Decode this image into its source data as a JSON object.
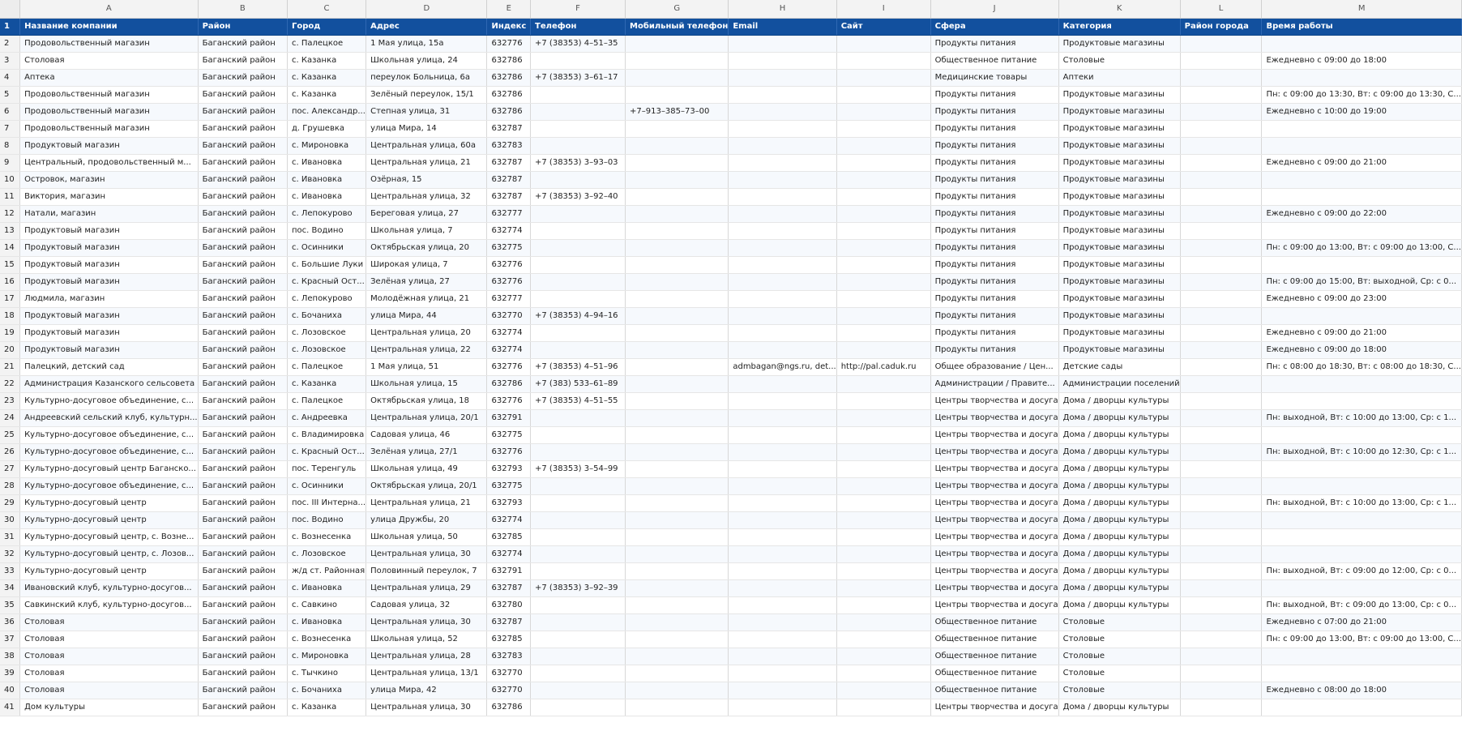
{
  "columns": [
    "A",
    "B",
    "C",
    "D",
    "E",
    "F",
    "G",
    "H",
    "I",
    "J",
    "K",
    "L",
    "M"
  ],
  "headers": [
    "Название компании",
    "Район",
    "Город",
    "Адрес",
    "Индекс",
    "Телефон",
    "Мобильный телефон",
    "Email",
    "Сайт",
    "Сфера",
    "Категория",
    "Район города",
    "Время работы"
  ],
  "rows": [
    {
      "n": "2",
      "cells": [
        "Продовольственный магазин",
        "Баганский район",
        "с. Палецкое",
        "1 Мая улица, 15а",
        "632776",
        "+7 (38353) 4–51–35",
        "",
        "",
        "",
        "Продукты питания",
        "Продуктовые магазины",
        "",
        ""
      ]
    },
    {
      "n": "3",
      "cells": [
        "Столовая",
        "Баганский район",
        "с. Казанка",
        "Школьная улица, 24",
        "632786",
        "",
        "",
        "",
        "",
        "Общественное питание",
        "Столовые",
        "",
        "Ежедневно с 09:00 до 18:00"
      ]
    },
    {
      "n": "4",
      "cells": [
        "Аптека",
        "Баганский район",
        "с. Казанка",
        "переулок Больница, 6а",
        "632786",
        "+7 (38353) 3–61–17",
        "",
        "",
        "",
        "Медицинские товары",
        "Аптеки",
        "",
        ""
      ]
    },
    {
      "n": "5",
      "cells": [
        "Продовольственный магазин",
        "Баганский район",
        "с. Казанка",
        "Зелёный переулок, 15/1",
        "632786",
        "",
        "",
        "",
        "",
        "Продукты питания",
        "Продуктовые магазины",
        "",
        "Пн: с 09:00 до 13:30, Вт: с 09:00 до 13:30, С..."
      ]
    },
    {
      "n": "6",
      "cells": [
        "Продовольственный магазин",
        "Баганский район",
        "пос. Александр...",
        "Степная улица, 31",
        "632786",
        "",
        "+7–913–385–73–00",
        "",
        "",
        "Продукты питания",
        "Продуктовые магазины",
        "",
        "Ежедневно с 10:00 до 19:00"
      ]
    },
    {
      "n": "7",
      "cells": [
        "Продовольственный магазин",
        "Баганский район",
        "д. Грушевка",
        "улица Мира, 14",
        "632787",
        "",
        "",
        "",
        "",
        "Продукты питания",
        "Продуктовые магазины",
        "",
        ""
      ]
    },
    {
      "n": "8",
      "cells": [
        "Продуктовый магазин",
        "Баганский район",
        "с. Мироновка",
        "Центральная улица, 60а",
        "632783",
        "",
        "",
        "",
        "",
        "Продукты питания",
        "Продуктовые магазины",
        "",
        ""
      ]
    },
    {
      "n": "9",
      "cells": [
        "Центральный, продовольственный м...",
        "Баганский район",
        "с. Ивановка",
        "Центральная улица, 21",
        "632787",
        "+7 (38353) 3–93–03",
        "",
        "",
        "",
        "Продукты питания",
        "Продуктовые магазины",
        "",
        "Ежедневно с 09:00 до 21:00"
      ]
    },
    {
      "n": "10",
      "cells": [
        "Островок, магазин",
        "Баганский район",
        "с. Ивановка",
        "Озёрная, 15",
        "632787",
        "",
        "",
        "",
        "",
        "Продукты питания",
        "Продуктовые магазины",
        "",
        ""
      ]
    },
    {
      "n": "11",
      "cells": [
        "Виктория, магазин",
        "Баганский район",
        "с. Ивановка",
        "Центральная улица, 32",
        "632787",
        "+7 (38353) 3–92–40",
        "",
        "",
        "",
        "Продукты питания",
        "Продуктовые магазины",
        "",
        ""
      ]
    },
    {
      "n": "12",
      "cells": [
        "Натали, магазин",
        "Баганский район",
        "с. Лепокурово",
        "Береговая улица, 27",
        "632777",
        "",
        "",
        "",
        "",
        "Продукты питания",
        "Продуктовые магазины",
        "",
        "Ежедневно с 09:00 до 22:00"
      ]
    },
    {
      "n": "13",
      "cells": [
        "Продуктовый магазин",
        "Баганский район",
        "пос. Водино",
        "Школьная улица, 7",
        "632774",
        "",
        "",
        "",
        "",
        "Продукты питания",
        "Продуктовые магазины",
        "",
        ""
      ]
    },
    {
      "n": "14",
      "cells": [
        "Продуктовый магазин",
        "Баганский район",
        "с. Осинники",
        "Октябрьская улица, 20",
        "632775",
        "",
        "",
        "",
        "",
        "Продукты питания",
        "Продуктовые магазины",
        "",
        "Пн: с 09:00 до 13:00, Вт: с 09:00 до 13:00, С..."
      ]
    },
    {
      "n": "15",
      "cells": [
        "Продуктовый магазин",
        "Баганский район",
        "с. Большие Луки",
        "Широкая улица, 7",
        "632776",
        "",
        "",
        "",
        "",
        "Продукты питания",
        "Продуктовые магазины",
        "",
        ""
      ]
    },
    {
      "n": "16",
      "cells": [
        "Продуктовый магазин",
        "Баганский район",
        "с. Красный Ост...",
        "Зелёная улица, 27",
        "632776",
        "",
        "",
        "",
        "",
        "Продукты питания",
        "Продуктовые магазины",
        "",
        "Пн: с 09:00 до 15:00, Вт: выходной, Ср: с 0..."
      ]
    },
    {
      "n": "17",
      "cells": [
        "Людмила, магазин",
        "Баганский район",
        "с. Лепокурово",
        "Молодёжная улица, 21",
        "632777",
        "",
        "",
        "",
        "",
        "Продукты питания",
        "Продуктовые магазины",
        "",
        "Ежедневно с 09:00 до 23:00"
      ]
    },
    {
      "n": "18",
      "cells": [
        "Продуктовый магазин",
        "Баганский район",
        "с. Бочаниха",
        "улица Мира, 44",
        "632770",
        "+7 (38353) 4–94–16",
        "",
        "",
        "",
        "Продукты питания",
        "Продуктовые магазины",
        "",
        ""
      ]
    },
    {
      "n": "19",
      "cells": [
        "Продуктовый магазин",
        "Баганский район",
        "с. Лозовское",
        "Центральная улица, 20",
        "632774",
        "",
        "",
        "",
        "",
        "Продукты питания",
        "Продуктовые магазины",
        "",
        "Ежедневно с 09:00 до 21:00"
      ]
    },
    {
      "n": "20",
      "cells": [
        "Продуктовый магазин",
        "Баганский район",
        "с. Лозовское",
        "Центральная улица, 22",
        "632774",
        "",
        "",
        "",
        "",
        "Продукты питания",
        "Продуктовые магазины",
        "",
        "Ежедневно с 09:00 до 18:00"
      ]
    },
    {
      "n": "21",
      "cells": [
        "Палецкий, детский сад",
        "Баганский район",
        "с. Палецкое",
        "1 Мая улица, 51",
        "632776",
        "+7 (38353) 4–51–96",
        "",
        "admbagan@ngs.ru, det...",
        "http://pal.caduk.ru",
        "Общее образование / Цен...",
        "Детские сады",
        "",
        "Пн: с 08:00 до 18:30, Вт: с 08:00 до 18:30, С..."
      ]
    },
    {
      "n": "22",
      "cells": [
        "Администрация Казанского сельсовета",
        "Баганский район",
        "с. Казанка",
        "Школьная улица, 15",
        "632786",
        "+7 (383) 533–61–89",
        "",
        "",
        "",
        "Администрации / Правите...",
        "Администрации поселений",
        "",
        ""
      ]
    },
    {
      "n": "23",
      "cells": [
        "Культурно-досуговое объединение, с...",
        "Баганский район",
        "с. Палецкое",
        "Октябрьская улица, 18",
        "632776",
        "+7 (38353) 4–51–55",
        "",
        "",
        "",
        "Центры творчества и досуга",
        "Дома / дворцы культуры",
        "",
        ""
      ]
    },
    {
      "n": "24",
      "cells": [
        "Андреевский сельский клуб, культурн...",
        "Баганский район",
        "с. Андреевка",
        "Центральная улица, 20/1",
        "632791",
        "",
        "",
        "",
        "",
        "Центры творчества и досуга",
        "Дома / дворцы культуры",
        "",
        "Пн: выходной, Вт: с 10:00 до 13:00, Ср: с 1..."
      ]
    },
    {
      "n": "25",
      "cells": [
        "Культурно-досуговое объединение, с...",
        "Баганский район",
        "с. Владимировка",
        "Садовая улица, 46",
        "632775",
        "",
        "",
        "",
        "",
        "Центры творчества и досуга",
        "Дома / дворцы культуры",
        "",
        ""
      ]
    },
    {
      "n": "26",
      "cells": [
        "Культурно-досуговое объединение, с...",
        "Баганский район",
        "с. Красный Ост...",
        "Зелёная улица, 27/1",
        "632776",
        "",
        "",
        "",
        "",
        "Центры творчества и досуга",
        "Дома / дворцы культуры",
        "",
        "Пн: выходной, Вт: с 10:00 до 12:30, Ср: с 1..."
      ]
    },
    {
      "n": "27",
      "cells": [
        "Культурно-досуговый центр Баганско...",
        "Баганский район",
        "пос. Теренгуль",
        "Школьная улица, 49",
        "632793",
        "+7 (38353) 3–54–99",
        "",
        "",
        "",
        "Центры творчества и досуга",
        "Дома / дворцы культуры",
        "",
        ""
      ]
    },
    {
      "n": "28",
      "cells": [
        "Культурно-досуговое объединение, с...",
        "Баганский район",
        "с. Осинники",
        "Октябрьская улица, 20/1",
        "632775",
        "",
        "",
        "",
        "",
        "Центры творчества и досуга",
        "Дома / дворцы культуры",
        "",
        ""
      ]
    },
    {
      "n": "29",
      "cells": [
        "Культурно-досуговый центр",
        "Баганский район",
        "пос. III Интерна...",
        "Центральная улица, 21",
        "632793",
        "",
        "",
        "",
        "",
        "Центры творчества и досуга",
        "Дома / дворцы культуры",
        "",
        "Пн: выходной, Вт: с 10:00 до 13:00, Ср: с 1..."
      ]
    },
    {
      "n": "30",
      "cells": [
        "Культурно-досуговый центр",
        "Баганский район",
        "пос. Водино",
        "улица Дружбы, 20",
        "632774",
        "",
        "",
        "",
        "",
        "Центры творчества и досуга",
        "Дома / дворцы культуры",
        "",
        ""
      ]
    },
    {
      "n": "31",
      "cells": [
        "Культурно-досуговый центр, с. Возне...",
        "Баганский район",
        "с. Вознесенка",
        "Школьная улица, 50",
        "632785",
        "",
        "",
        "",
        "",
        "Центры творчества и досуга",
        "Дома / дворцы культуры",
        "",
        ""
      ]
    },
    {
      "n": "32",
      "cells": [
        "Культурно-досуговый центр, с. Лозов...",
        "Баганский район",
        "с. Лозовское",
        "Центральная улица, 30",
        "632774",
        "",
        "",
        "",
        "",
        "Центры творчества и досуга",
        "Дома / дворцы культуры",
        "",
        ""
      ]
    },
    {
      "n": "33",
      "cells": [
        "Культурно-досуговый центр",
        "Баганский район",
        "ж/д ст. Районная",
        "Половинный переулок, 7",
        "632791",
        "",
        "",
        "",
        "",
        "Центры творчества и досуга",
        "Дома / дворцы культуры",
        "",
        "Пн: выходной, Вт: с 09:00 до 12:00, Ср: с 0..."
      ]
    },
    {
      "n": "34",
      "cells": [
        "Ивановский клуб, культурно-досугов...",
        "Баганский район",
        "с. Ивановка",
        "Центральная улица, 29",
        "632787",
        "+7 (38353) 3–92–39",
        "",
        "",
        "",
        "Центры творчества и досуга",
        "Дома / дворцы культуры",
        "",
        ""
      ]
    },
    {
      "n": "35",
      "cells": [
        "Савкинский клуб, культурно-досугов...",
        "Баганский район",
        "с. Савкино",
        "Садовая улица, 32",
        "632780",
        "",
        "",
        "",
        "",
        "Центры творчества и досуга",
        "Дома / дворцы культуры",
        "",
        "Пн: выходной, Вт: с 09:00 до 13:00, Ср: с 0..."
      ]
    },
    {
      "n": "36",
      "cells": [
        "Столовая",
        "Баганский район",
        "с. Ивановка",
        "Центральная улица, 30",
        "632787",
        "",
        "",
        "",
        "",
        "Общественное питание",
        "Столовые",
        "",
        "Ежедневно с 07:00 до 21:00"
      ]
    },
    {
      "n": "37",
      "cells": [
        "Столовая",
        "Баганский район",
        "с. Вознесенка",
        "Школьная улица, 52",
        "632785",
        "",
        "",
        "",
        "",
        "Общественное питание",
        "Столовые",
        "",
        "Пн: с 09:00 до 13:00, Вт: с 09:00 до 13:00, С..."
      ]
    },
    {
      "n": "38",
      "cells": [
        "Столовая",
        "Баганский район",
        "с. Мироновка",
        "Центральная улица, 28",
        "632783",
        "",
        "",
        "",
        "",
        "Общественное питание",
        "Столовые",
        "",
        ""
      ]
    },
    {
      "n": "39",
      "cells": [
        "Столовая",
        "Баганский район",
        "с. Тычкино",
        "Центральная улица, 13/1",
        "632770",
        "",
        "",
        "",
        "",
        "Общественное питание",
        "Столовые",
        "",
        ""
      ]
    },
    {
      "n": "40",
      "cells": [
        "Столовая",
        "Баганский район",
        "с. Бочаниха",
        "улица Мира, 42",
        "632770",
        "",
        "",
        "",
        "",
        "Общественное питание",
        "Столовые",
        "",
        "Ежедневно с 08:00 до 18:00"
      ]
    },
    {
      "n": "41",
      "cells": [
        "Дом культуры",
        "Баганский район",
        "с. Казанка",
        "Центральная улица, 30",
        "632786",
        "",
        "",
        "",
        "",
        "Центры творчества и досуга",
        "Дома / дворцы культуры",
        "",
        ""
      ]
    }
  ],
  "colors": {
    "header_bg": "#12509e",
    "header_text": "#ffffff",
    "grid_line": "#d8d8d8"
  }
}
